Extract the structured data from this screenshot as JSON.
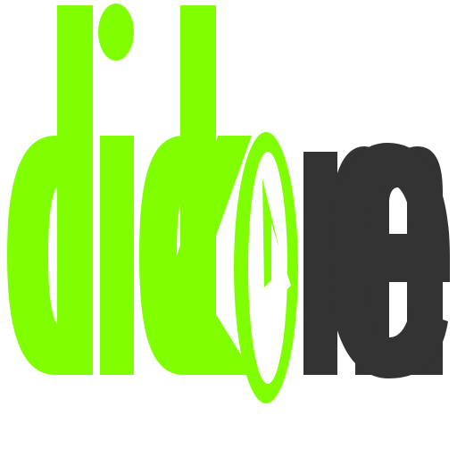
{
  "logo": {
    "word_left": "click",
    "word_right": "me",
    "accent_color": "#7fff00",
    "dark_color": "#333333",
    "icon": "pointer-circle-icon"
  }
}
